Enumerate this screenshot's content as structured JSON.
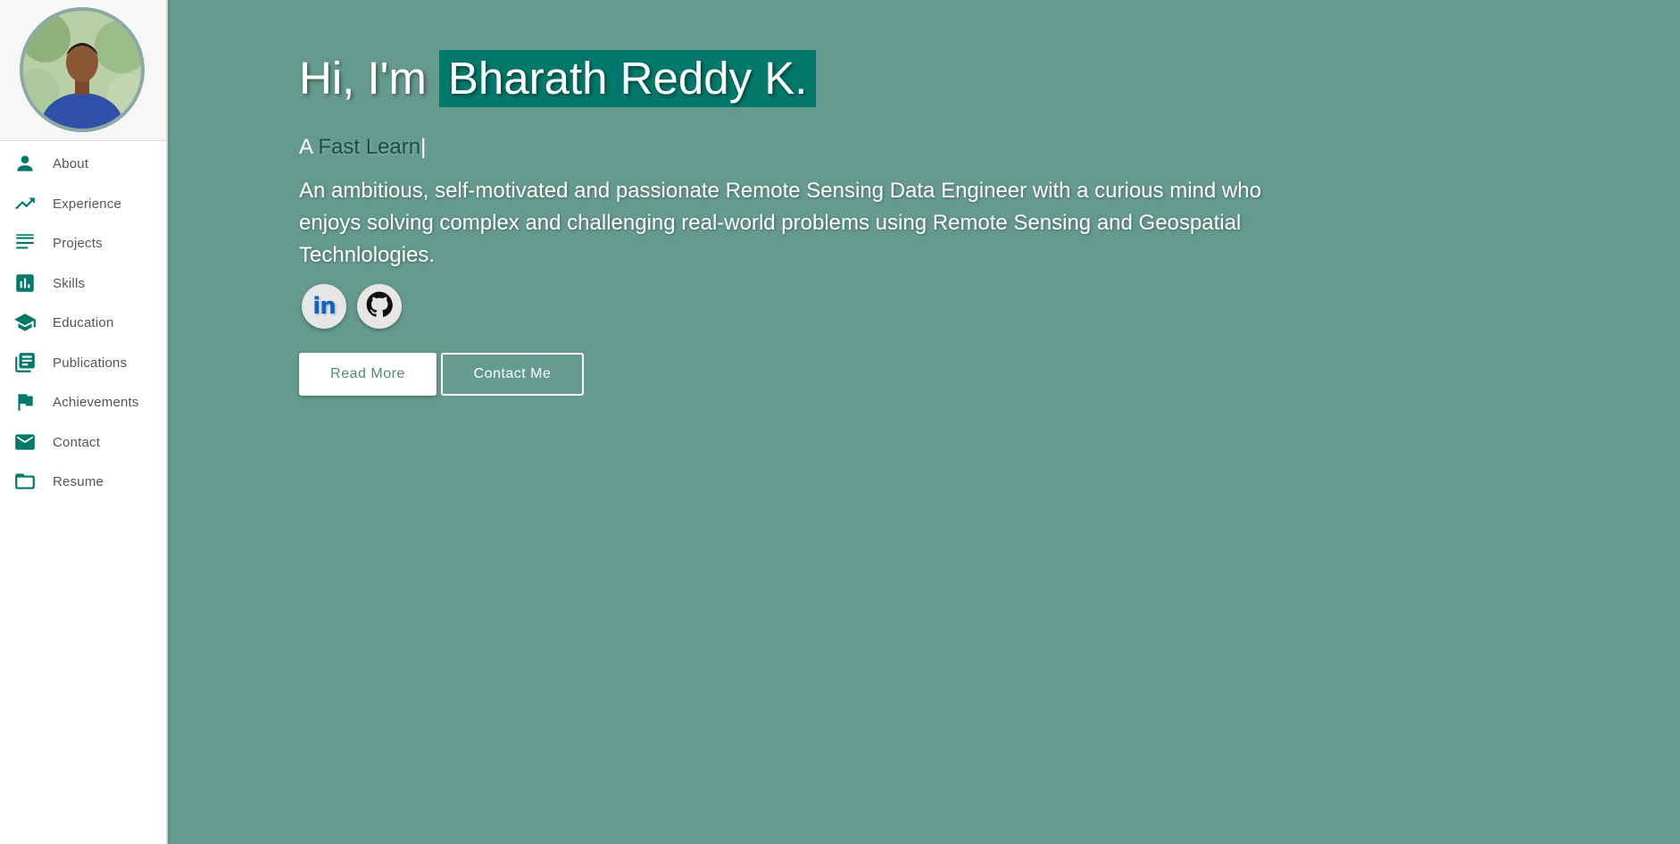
{
  "sidebar": {
    "items": [
      {
        "label": "About",
        "icon": "person-icon"
      },
      {
        "label": "Experience",
        "icon": "trending-up-icon"
      },
      {
        "label": "Projects",
        "icon": "notes-icon"
      },
      {
        "label": "Skills",
        "icon": "bar-chart-icon"
      },
      {
        "label": "Education",
        "icon": "graduation-cap-icon"
      },
      {
        "label": "Publications",
        "icon": "library-books-icon"
      },
      {
        "label": "Achievements",
        "icon": "flag-icon"
      },
      {
        "label": "Contact",
        "icon": "mail-icon"
      },
      {
        "label": "Resume",
        "icon": "folder-icon"
      }
    ]
  },
  "hero": {
    "greeting": "Hi, I'm",
    "name": "Bharath Reddy K.",
    "subtitle_prefix": "A",
    "subtitle_typed": "Fast Learn",
    "subtitle_cursor": "|",
    "bio": "An ambitious, self-motivated and passionate Remote Sensing Data Engineer with a curious mind who enjoys solving complex and challenging real-world problems using Remote Sensing and Geospatial Technlologies.",
    "socials": [
      {
        "name": "linkedin-icon",
        "text": "in"
      },
      {
        "name": "github-icon"
      }
    ],
    "read_more_label": "Read More",
    "contact_label": "Contact Me"
  },
  "colors": {
    "background": "#659b8d",
    "accent": "#00796b",
    "sidebar": "#ffffff"
  }
}
